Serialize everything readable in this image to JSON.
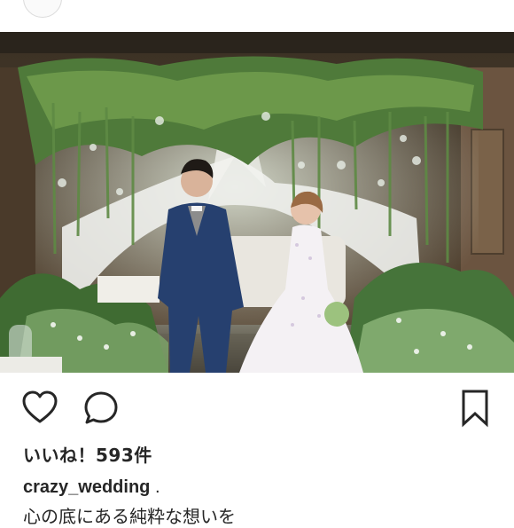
{
  "post": {
    "header_username": "crazy_wedding",
    "photo_alt": "",
    "likes_text": "いいね！593件",
    "caption": {
      "username": "crazy_wedding",
      "dot": " .",
      "text_line": "心の底にある純粋な想いを"
    }
  },
  "icons": {
    "like": "heart-outline-icon",
    "comment": "speech-bubble-icon",
    "save": "bookmark-icon"
  },
  "colors": {
    "text": "#262626",
    "icon": "#262626",
    "background": "#ffffff"
  }
}
